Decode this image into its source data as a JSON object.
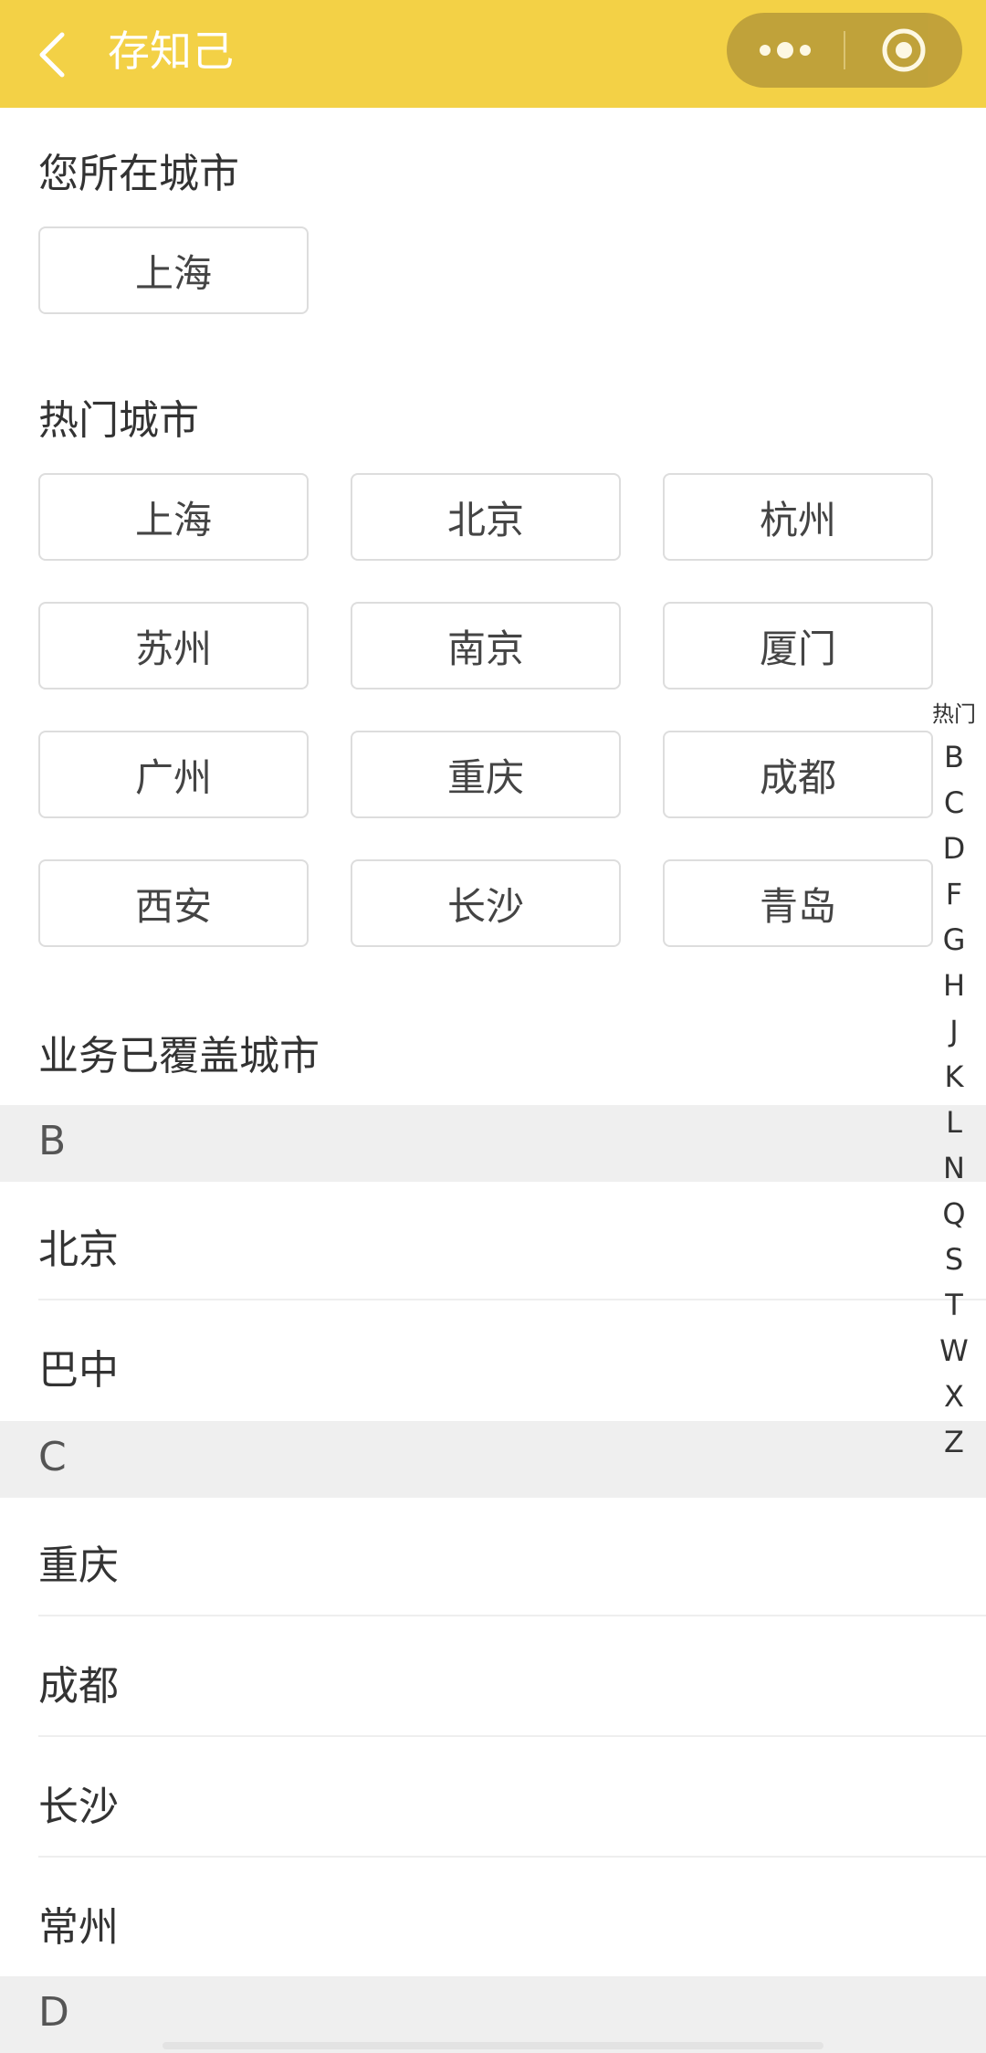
{
  "header": {
    "title": "存知己",
    "back_icon": "chevron-left-icon",
    "menu_icon": "more-dots-icon",
    "close_icon": "target-circle-icon"
  },
  "current_city": {
    "title": "您所在城市",
    "city": "上海"
  },
  "hot_cities": {
    "title": "热门城市",
    "cities": [
      "上海",
      "北京",
      "杭州",
      "苏州",
      "南京",
      "厦门",
      "广州",
      "重庆",
      "成都",
      "西安",
      "长沙",
      "青岛"
    ]
  },
  "covered": {
    "title": "业务已覆盖城市",
    "groups": [
      {
        "letter": "B",
        "cities": [
          "北京",
          "巴中"
        ]
      },
      {
        "letter": "C",
        "cities": [
          "重庆",
          "成都",
          "长沙",
          "常州"
        ]
      },
      {
        "letter": "D",
        "cities": []
      }
    ]
  },
  "index": [
    "热门",
    "B",
    "C",
    "D",
    "F",
    "G",
    "H",
    "J",
    "K",
    "L",
    "N",
    "Q",
    "S",
    "T",
    "W",
    "X",
    "Z"
  ],
  "colors": {
    "header_bg": "#f3d146",
    "group_bg": "#efefef"
  }
}
